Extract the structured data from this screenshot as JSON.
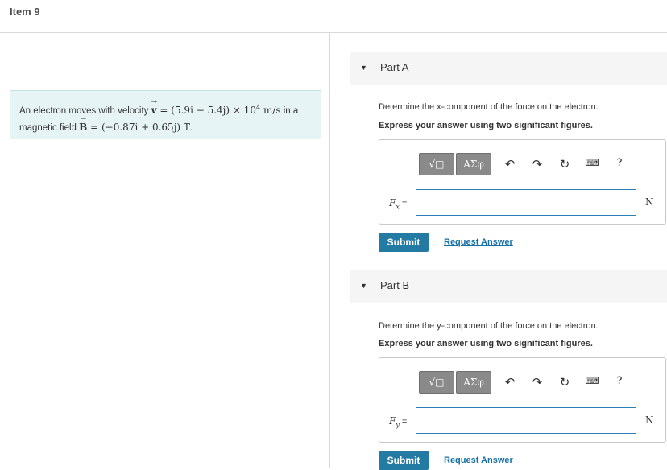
{
  "header": {
    "title": "Item 9"
  },
  "problem": {
    "text_1": "An electron moves with velocity ",
    "v_symbol": "v",
    "eq_1": " = ",
    "v_value": "(5.9i − 5.4j) × 10",
    "v_exp": "4",
    "v_units": " m/s",
    "text_2": " in a",
    "text_3": "magnetic field ",
    "b_symbol": "B",
    "eq_2": " = ",
    "b_value": "(−0.87i + 0.65j) T",
    "text_4": "."
  },
  "parts": [
    {
      "label": "Part A",
      "question": "Determine the x-component of the force on the electron.",
      "instruction": "Express your answer using two significant figures.",
      "field_symbol": "F",
      "field_sub": "x",
      "field_eq": " =",
      "input_value": "",
      "unit": "N",
      "submit": "Submit",
      "request": "Request Answer"
    },
    {
      "label": "Part B",
      "question": "Determine the y-component of the force on the electron.",
      "instruction": "Express your answer using two significant figures.",
      "field_symbol": "F",
      "field_sub": "y",
      "field_eq": " =",
      "input_value": "",
      "unit": "N",
      "submit": "Submit",
      "request": "Request Answer"
    }
  ],
  "toolbar": {
    "template_btn": "√□",
    "greek_btn": "ΑΣφ",
    "undo_icon": "undo-icon",
    "redo_icon": "redo-icon",
    "reset_icon": "reset-icon",
    "keyboard_icon": "keyboard-icon",
    "help": "?"
  },
  "colors": {
    "accent": "#237aa2",
    "link": "#1570a6",
    "problem_bg": "#e6f4f5"
  }
}
